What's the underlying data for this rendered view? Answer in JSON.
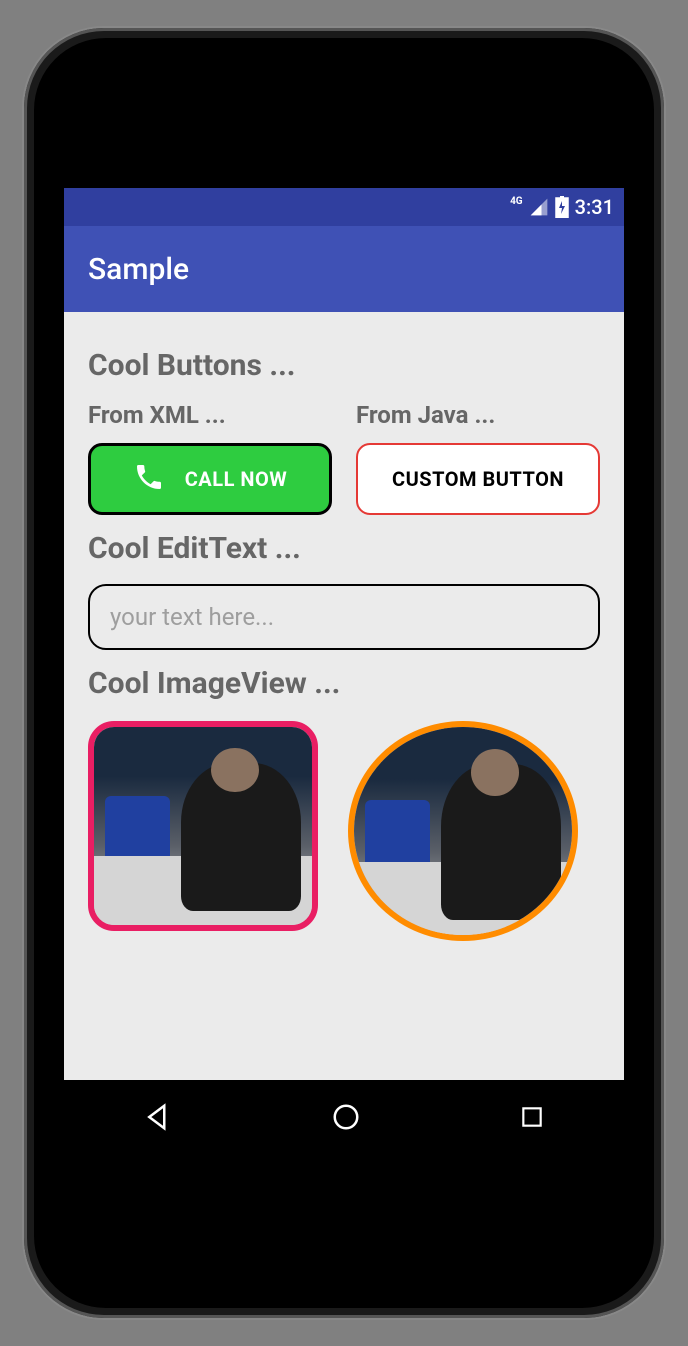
{
  "statusbar": {
    "network_label": "4G",
    "time": "3:31"
  },
  "appbar": {
    "title": "Sample"
  },
  "sections": {
    "buttons": {
      "title": "Cool Buttons ...",
      "xml_label": "From XML ...",
      "java_label": "From Java ...",
      "call_button": "CALL NOW",
      "custom_button": "CUSTOM BUTTON"
    },
    "edittext": {
      "title": "Cool EditText ...",
      "placeholder": "your text here..."
    },
    "imageview": {
      "title": "Cool ImageView ..."
    }
  },
  "colors": {
    "primary": "#3F51B5",
    "primary_dark": "#303F9F",
    "green_button": "#2ecc40",
    "red_border": "#e53935",
    "pink_border": "#e91e63",
    "orange_border": "#ff8c00"
  }
}
